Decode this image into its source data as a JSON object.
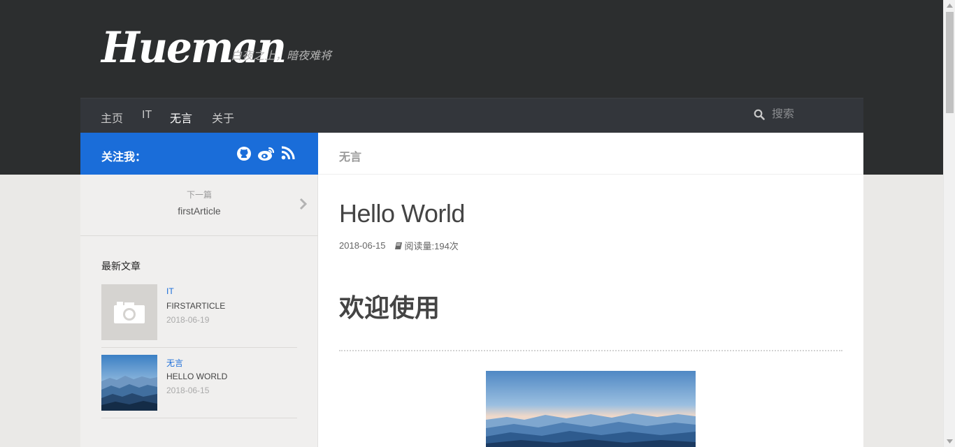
{
  "header": {
    "logo": "Hueman",
    "tagline": "白夜之上，暗夜难将"
  },
  "nav": {
    "items": [
      {
        "label": "主页",
        "active": false
      },
      {
        "label": "IT",
        "active": false
      },
      {
        "label": "无言",
        "active": true
      },
      {
        "label": "关于",
        "active": false
      }
    ],
    "search_placeholder": "搜索"
  },
  "sidebar": {
    "follow_label": "关注我：",
    "social_icons": [
      "github-icon",
      "weibo-icon",
      "rss-icon"
    ],
    "next_post": {
      "label": "下一篇",
      "title": "firstArticle"
    },
    "recent_heading": "最新文章",
    "recent": [
      {
        "category": "IT",
        "title": "firstArticle",
        "date": "2018-06-19",
        "thumb": "camera-placeholder-icon"
      },
      {
        "category": "无言",
        "title": "Hello World",
        "date": "2018-06-15",
        "thumb": "mountain-landscape-image"
      }
    ]
  },
  "main": {
    "page_header": "无言",
    "post": {
      "title": "Hello World",
      "date": "2018-06-15",
      "views": "阅读量:194次",
      "heading": "欢迎使用"
    }
  },
  "colors": {
    "topbar": "#2c2e2f",
    "navbar": "#33363b",
    "accent": "#1a6dd9",
    "sidebar_bg": "#f0efee",
    "page_bg": "#eae9e7"
  }
}
